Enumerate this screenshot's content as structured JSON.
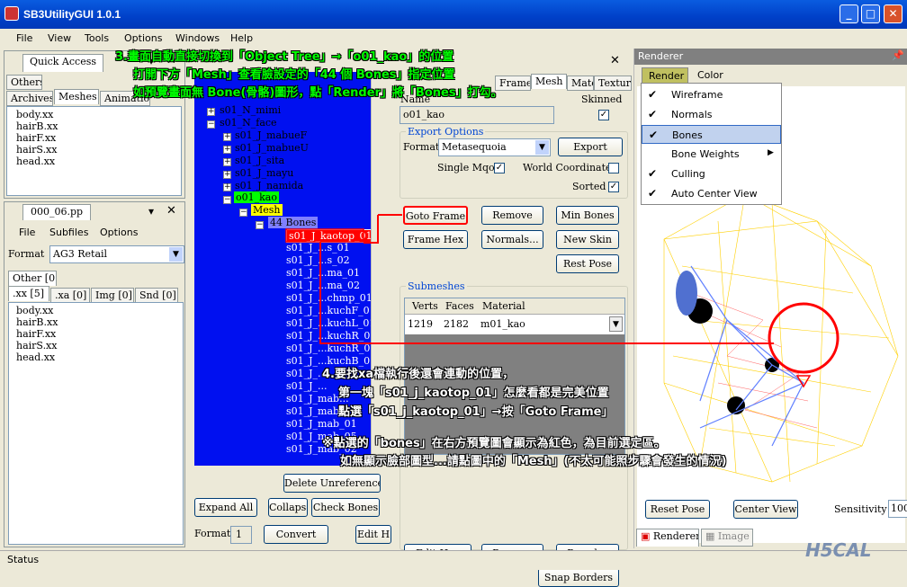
{
  "window": {
    "title": "SB3UtilityGUI 1.0.1"
  },
  "menu": [
    "File",
    "View",
    "Tools",
    "Options",
    "Windows",
    "Help"
  ],
  "left": {
    "quick_access": "Quick Access",
    "tabs_top": [
      "Others",
      "Archives",
      "Meshes",
      "Animations"
    ],
    "files": [
      "body.xx",
      "hairB.xx",
      "hairF.xx",
      "hairS.xx",
      "head.xx"
    ],
    "pp_tab": "000_06.pp",
    "sub_menu": [
      "File",
      "Subfiles",
      "Options"
    ],
    "format_label": "Format",
    "format_value": "AG3 Retail",
    "other_tab": "Other [0]",
    "ext_tabs": [
      ".xx [5]",
      ".xa [0]",
      "Img [0]",
      "Snd [0]"
    ],
    "files2": [
      "body.xx",
      "hairB.xx",
      "hairF.xx",
      "hairS.xx",
      "head.xx"
    ]
  },
  "tree": {
    "nodes": [
      {
        "label": "s01_N_mimi",
        "level": 1
      },
      {
        "label": "s01_N_face",
        "level": 1
      },
      {
        "label": "s01_J_mabueF",
        "level": 2
      },
      {
        "label": "s01_J_mabueU",
        "level": 2
      },
      {
        "label": "s01_J_sita",
        "level": 2
      },
      {
        "label": "s01_J_mayu",
        "level": 2
      },
      {
        "label": "s01_J_namida",
        "level": 2
      },
      {
        "label": "o01_kao",
        "level": 2
      },
      {
        "label": "Mesh",
        "level": 3
      },
      {
        "label": "44 Bones",
        "level": 4
      },
      {
        "label": "s01_J_kaotop_01",
        "level": 5
      }
    ],
    "bones": [
      "s01_J_...s_01",
      "s01_J_...s_02",
      "s01_J_...ma_01",
      "s01_J_...ma_02",
      "s01_J_...chmp_01",
      "s01_J_...kuchF_01",
      "s01_J_...kuchL_01",
      "s01_J_...kuchR_02",
      "s01_J_...kuchR_01",
      "s01_J_...kuchB_01",
      "s01_J_...",
      "s01_J_...",
      "s01_J_mab...",
      "s01_J_mab...",
      "s01_J_mab_01",
      "s01_J_mab_05",
      "s01_J_mab_02"
    ],
    "buttons": {
      "expand": "Expand All",
      "collapse": "Collapse",
      "check": "Check Bones",
      "delete_unref": "Delete Unreferenced"
    },
    "format_label": "Format",
    "format_value": "1",
    "convert": "Convert",
    "edit": "Edit H"
  },
  "mesh_panel": {
    "tabs": [
      "Frame",
      "Mesh",
      "Material",
      "Texture"
    ],
    "name_label": "Name",
    "skinned_label": "Skinned",
    "name_value": "o01_kao",
    "export_options": "Export Options",
    "format_label": "Format",
    "format_value": "Metasequoia",
    "export": "Export",
    "single_mqo": "Single Mqo",
    "world_coords": "World Coordinates",
    "sorted": "Sorted",
    "buttons": [
      "Goto Frame",
      "Remove",
      "Min Bones",
      "Frame Hex",
      "Normals...",
      "New Skin",
      "Rest Pose"
    ],
    "submeshes": "Submeshes",
    "cols": [
      "Verts",
      "Faces",
      "Material"
    ],
    "row": [
      "1219",
      "2182",
      "m01_kao"
    ],
    "bottom_buttons": [
      "Edit Hex",
      "Remove",
      "Reorder",
      "Snap Borders"
    ]
  },
  "renderer": {
    "title": "Renderer",
    "menu": [
      "Render",
      "Color"
    ],
    "items": [
      {
        "label": "Wireframe",
        "checked": true
      },
      {
        "label": "Normals",
        "checked": true
      },
      {
        "label": "Bones",
        "checked": true
      },
      {
        "label": "Bone Weights",
        "checked": false
      },
      {
        "label": "Culling",
        "checked": true
      },
      {
        "label": "Auto Center View",
        "checked": true
      }
    ],
    "reset_pose": "Reset Pose",
    "center_view": "Center View",
    "sensitivity": "Sensitivity",
    "sensitivity_value": "100",
    "tabs": [
      "Renderer",
      "Image"
    ]
  },
  "status": "Status",
  "annotations": {
    "a3_1": "3.畫面自動直接切換到「Object Tree」→「o01_kao」的位置",
    "a3_2": "打開下方「Mesh」查看臉設定的「44 個 Bones」指定位置",
    "a3_3": "如預覽畫面無 Bone(骨骼)圖形，點「Render」將「Bones」打勾。",
    "a4_1": "4.要找xa檔執行後還會連動的位置，",
    "a4_2": "第一塊「s01_j_kaotop_01」怎麼看都是完美位置",
    "a4_3": "點選「s01_j_kaotop_01」→按「Goto Frame」",
    "n1": "※點選的「bones」在右方預覽圖會顯示為紅色，為目前選定區。",
    "n2": "如無顯示臉部圖型...請點圖中的「Mesh」(不太可能照步驟會發生的情況)",
    "watermark": "H5CAL"
  }
}
